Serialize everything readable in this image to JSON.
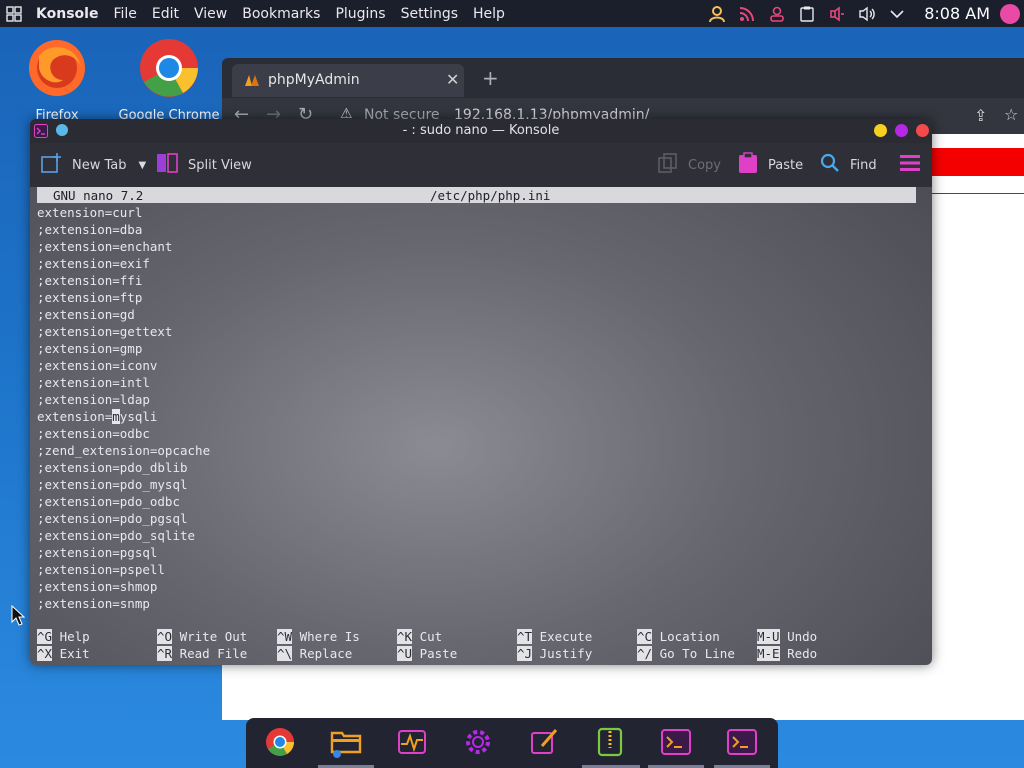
{
  "top_panel": {
    "app_name": "Konsole",
    "menu": [
      "File",
      "Edit",
      "View",
      "Bookmarks",
      "Plugins",
      "Settings",
      "Help"
    ],
    "clock": "8:08 AM"
  },
  "desktop": {
    "icons": [
      {
        "label": "Firefox"
      },
      {
        "label": "Google Chrome"
      }
    ]
  },
  "browser": {
    "tab_title": "phpMyAdmin",
    "security_label": "Not secure",
    "url": "192.168.1.13/phpmyadmin/"
  },
  "konsole": {
    "title": "- : sudo nano — Konsole",
    "toolbar": {
      "new_tab": "New Tab",
      "split_view": "Split View",
      "copy": "Copy",
      "paste": "Paste",
      "find": "Find"
    },
    "nano": {
      "version": "GNU nano 7.2",
      "filename": "/etc/php/php.ini",
      "lines": [
        "extension=curl",
        ";extension=dba",
        ";extension=enchant",
        ";extension=exif",
        ";extension=ffi",
        ";extension=ftp",
        ";extension=gd",
        ";extension=gettext",
        ";extension=gmp",
        ";extension=iconv",
        ";extension=intl",
        ";extension=ldap",
        "extension=mysqli",
        ";extension=odbc",
        ";zend_extension=opcache",
        ";extension=pdo_dblib",
        ";extension=pdo_mysql",
        ";extension=pdo_odbc",
        ";extension=pdo_pgsql",
        ";extension=pdo_sqlite",
        ";extension=pgsql",
        ";extension=pspell",
        ";extension=shmop",
        ";extension=snmp"
      ],
      "cursor_line_prefix": "extension=",
      "cursor_char": "m",
      "cursor_line_suffix": "ysqli",
      "shortcuts_row1": [
        {
          "key": "^G",
          "label": "Help"
        },
        {
          "key": "^O",
          "label": "Write Out"
        },
        {
          "key": "^W",
          "label": "Where Is"
        },
        {
          "key": "^K",
          "label": "Cut"
        },
        {
          "key": "^T",
          "label": "Execute"
        },
        {
          "key": "^C",
          "label": "Location"
        },
        {
          "key": "M-U",
          "label": "Undo"
        }
      ],
      "shortcuts_row2": [
        {
          "key": "^X",
          "label": "Exit"
        },
        {
          "key": "^R",
          "label": "Read File"
        },
        {
          "key": "^\\",
          "label": "Replace"
        },
        {
          "key": "^U",
          "label": "Paste"
        },
        {
          "key": "^J",
          "label": "Justify"
        },
        {
          "key": "^/",
          "label": "Go To Line"
        },
        {
          "key": "M-E",
          "label": "Redo"
        }
      ]
    }
  },
  "colors": {
    "accent_magenta": "#e040c8",
    "window_close": "#f44a4a",
    "window_min": "#f5d020",
    "window_max": "#b428e6"
  }
}
